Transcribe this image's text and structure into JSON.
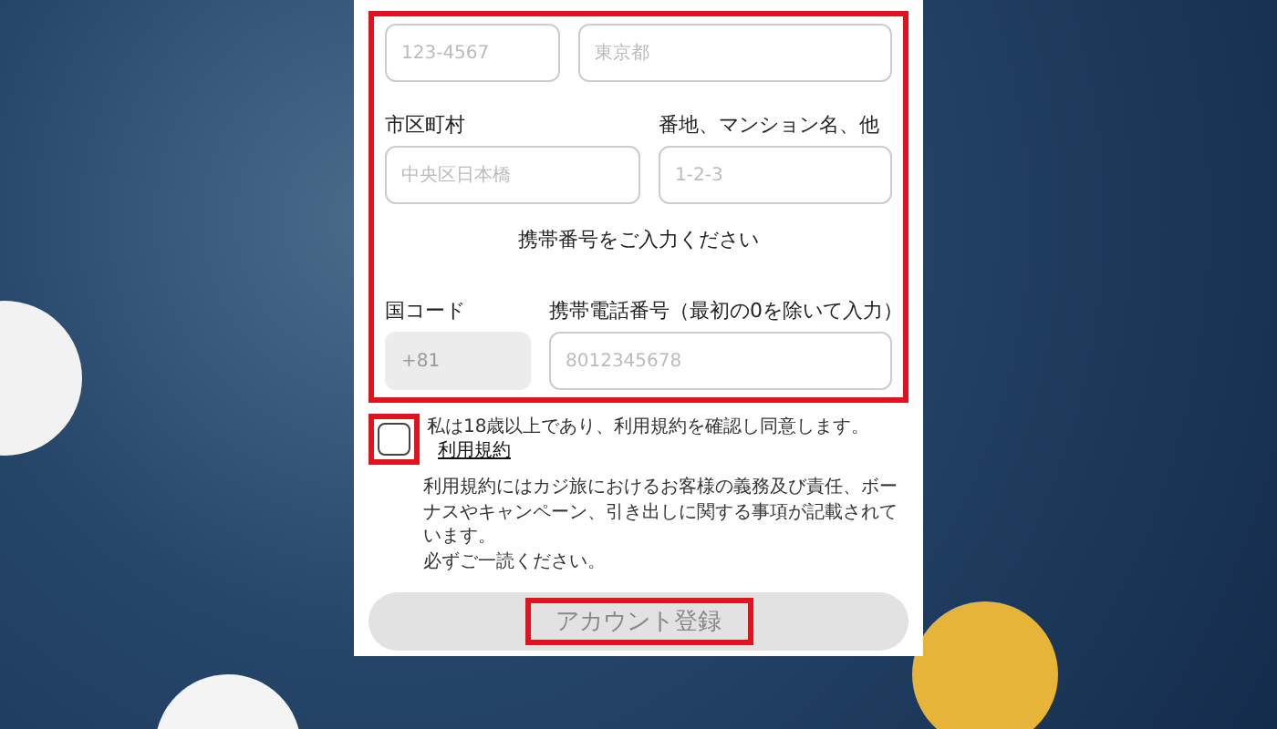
{
  "address_row": [
    {
      "placeholder": "123-4567"
    },
    {
      "placeholder": "東京都"
    }
  ],
  "city_row": [
    {
      "label": "市区町村",
      "placeholder": "中央区日本橋"
    },
    {
      "label": "番地、マンション名、他",
      "placeholder": "1-2-3"
    }
  ],
  "phone_heading": "携帯番号をご入力ください",
  "phone_row": [
    {
      "label": "国コード",
      "value": "+81",
      "disabled": true
    },
    {
      "label": "携帯電話番号（最初の0を除いて入力）",
      "placeholder": "8012345678",
      "disabled": false
    }
  ],
  "agreement": {
    "checked": false,
    "text": "私は18歳以上であり、利用規約を確認し同意します。",
    "link": "利用規約"
  },
  "notes": [
    "利用規約にはカジ旅におけるお客様の義務及び責任、ボーナスやキャンペーン、引き出しに関する事項が記載されています。",
    "必ずご一読ください。"
  ],
  "submit": {
    "label": "アカウント登録",
    "disabled": true
  }
}
